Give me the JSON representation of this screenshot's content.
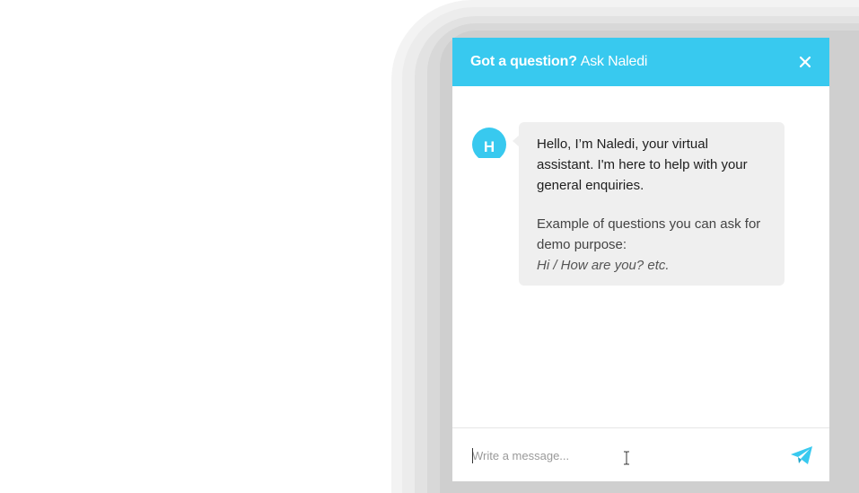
{
  "chat_widget": {
    "header": {
      "title": "Got a question?",
      "subtitle": "Ask Naledi",
      "close_icon": "close-icon"
    },
    "bot": {
      "avatar_initial": "H",
      "greeting": "Hello, I’m Naledi, your virtual assistant. I'm here to help with your general enquiries.",
      "examples_label": "Example of questions you can ask for demo purpose:",
      "examples_sample": "Hi / How are you? etc."
    },
    "composer": {
      "placeholder": "Write a message...",
      "value": "",
      "send_icon": "paper-plane-icon"
    }
  },
  "colors": {
    "accent": "#38c9ef",
    "bubble_background": "#efefef",
    "header_text": "#ffffff"
  }
}
